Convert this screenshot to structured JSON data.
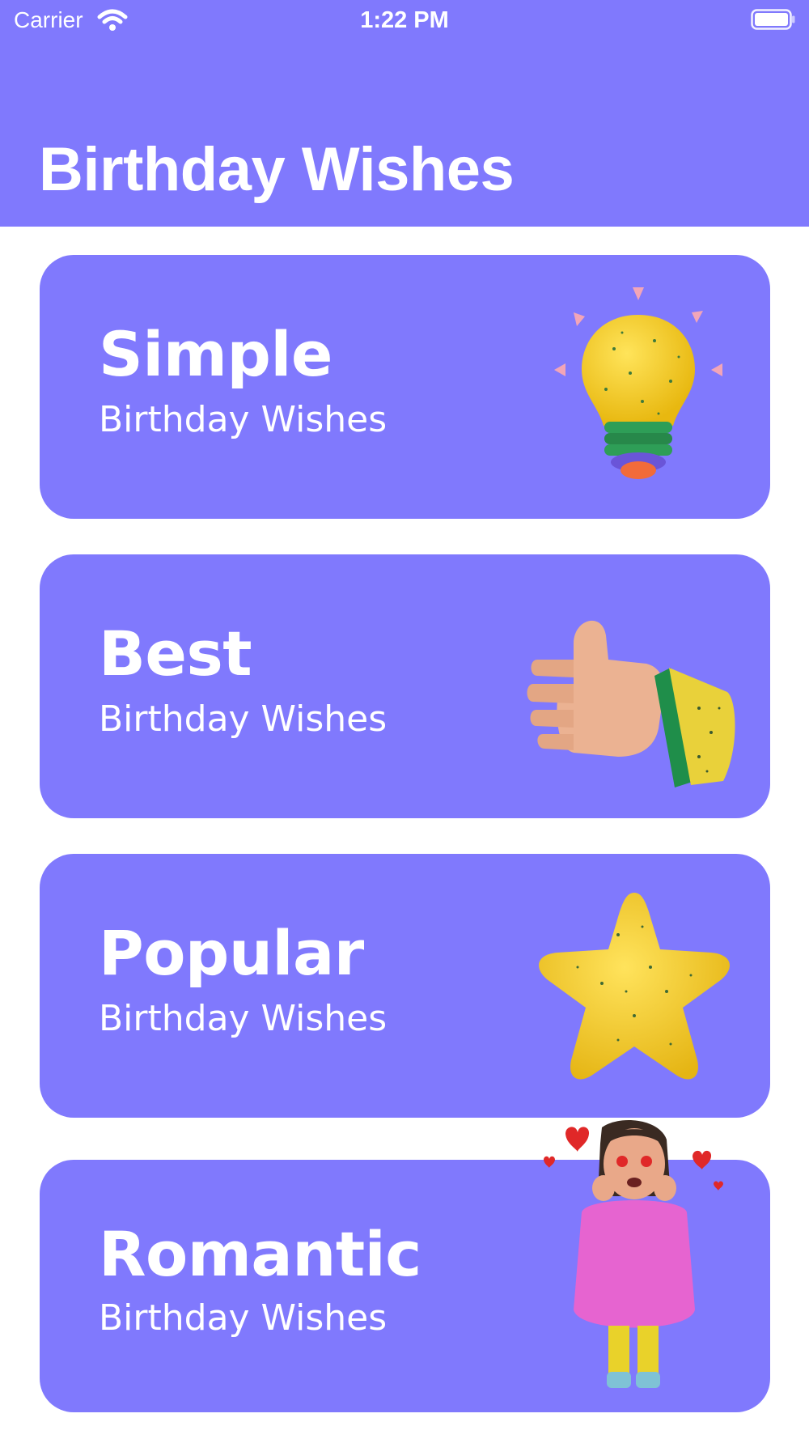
{
  "status_bar": {
    "carrier": "Carrier",
    "time": "1:22 PM"
  },
  "header": {
    "title": "Birthday Wishes"
  },
  "categories": [
    {
      "title": "Simple",
      "subtitle": "Birthday Wishes",
      "icon": "lightbulb-icon"
    },
    {
      "title": "Best",
      "subtitle": "Birthday Wishes",
      "icon": "thumbs-up-icon"
    },
    {
      "title": "Popular",
      "subtitle": "Birthday Wishes",
      "icon": "star-icon"
    },
    {
      "title": "Romantic",
      "subtitle": "Birthday Wishes",
      "icon": "girl-in-love-icon"
    }
  ],
  "colors": {
    "accent": "#8079FD",
    "background": "#FFFFFF",
    "text": "#FFFFFF"
  }
}
